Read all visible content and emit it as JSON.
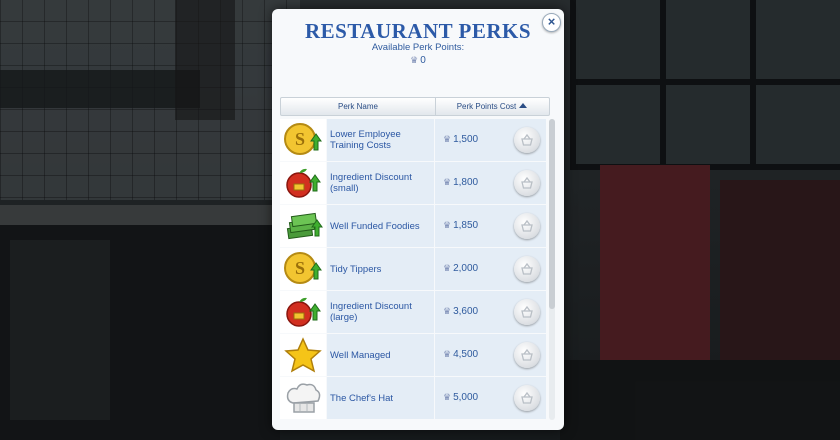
{
  "dialog": {
    "title": "Restaurant Perks",
    "available_label": "Available Perk Points:",
    "available_points": "0",
    "close_glyph": "×"
  },
  "table": {
    "col_name": "Perk Name",
    "col_cost": "Perk Points Cost",
    "sort_direction": "ascending"
  },
  "perks": [
    {
      "name": "Lower Employee Training Costs",
      "cost": "1,500",
      "icon": "gold-simoleon-icon"
    },
    {
      "name": "Ingredient Discount (small)",
      "cost": "1,800",
      "icon": "apple-discount-icon"
    },
    {
      "name": "Well Funded Foodies",
      "cost": "1,850",
      "icon": "money-stack-icon"
    },
    {
      "name": "Tidy Tippers",
      "cost": "2,000",
      "icon": "gold-simoleon-icon"
    },
    {
      "name": "Ingredient Discount (large)",
      "cost": "3,600",
      "icon": "apple-discount-icon"
    },
    {
      "name": "Well Managed",
      "cost": "4,500",
      "icon": "star-icon"
    },
    {
      "name": "The Chef's Hat",
      "cost": "5,000",
      "icon": "chef-hat-icon"
    }
  ],
  "colors": {
    "accent": "#2c5aa8",
    "row_bg": "#e4edf6"
  }
}
